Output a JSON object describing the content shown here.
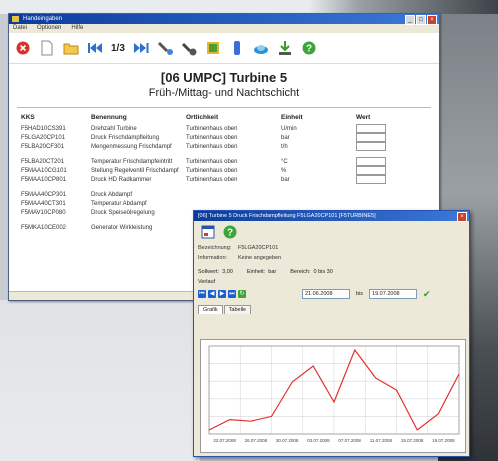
{
  "window": {
    "title": "Handeingaben",
    "menu": [
      "Datei",
      "Optionen",
      "Hilfe"
    ]
  },
  "toolbar": {
    "counter": "1/3"
  },
  "header": {
    "title": "[06 UMPC] Turbine 5",
    "subtitle": "Früh-/Mittag- und Nachtschicht"
  },
  "table": {
    "columns": [
      "KKS",
      "Benennung",
      "Ortlichkeit",
      "Einheit",
      "Wert"
    ],
    "rows": [
      {
        "kks": "F5HAD10CS391",
        "name": "Drehzahl Turbine",
        "ort": "Turbinenhaus oben",
        "unit": "U/min"
      },
      {
        "kks": "F5LGA20CP101",
        "name": "Druck Frischdampfleitung",
        "ort": "Turbinenhaus oben",
        "unit": "bar"
      },
      {
        "kks": "F5LBA20CF301",
        "name": "Mengenmessung Frischdampf",
        "ort": "Turbinenhaus oben",
        "unit": "t/h"
      },
      {
        "kks": "F5LBA20CT201",
        "name": "Temperatur Frischdampfeintritt",
        "ort": "Turbinenhaus oben",
        "unit": "°C"
      },
      {
        "kks": "F5MAA10CG101",
        "name": "Stellung Regelventil Frischdampf",
        "ort": "Turbinenhaus oben",
        "unit": "%"
      },
      {
        "kks": "F5MAA10CP801",
        "name": "Druck HD Radkammer",
        "ort": "Turbinenhaus oben",
        "unit": "bar"
      },
      {
        "kks": "F5MAA40CP301",
        "name": "Druck Abdampf",
        "ort": "",
        "unit": ""
      },
      {
        "kks": "F5MAA40CT301",
        "name": "Temperatur Abdampf",
        "ort": "",
        "unit": ""
      },
      {
        "kks": "F5MAV10CP080",
        "name": "Druck Speiseölregelung",
        "ort": "",
        "unit": ""
      },
      {
        "kks": "F5MKA10CE002",
        "name": "Generator Wirkleistung",
        "ort": "",
        "unit": ""
      }
    ]
  },
  "popup": {
    "title": "[06] Turbine 5 Druck Frischdampfleitung F5LGA20CP101 [F5TURBINE5]",
    "bezeichnung_label": "Bezeichnung:",
    "bezeichnung_value": "F5LGA20CP101",
    "information_label": "Information:",
    "information_value": "Keine angegeben",
    "sollwert_label": "Sollwert:",
    "sollwert_value": "3,00",
    "einheit_label": "Einheit:",
    "einheit_value": "bar",
    "bereich_label": "Bereich:",
    "bereich_value": "0 bis 30",
    "verlauf_label": "Verlauf",
    "date_from": "21.06.2008",
    "bis_label": "bis",
    "date_to": "19.07.2008",
    "tabs": [
      "Grafik",
      "Tabelle"
    ]
  },
  "colors": {
    "line": "#e43030",
    "title_start": "#0a3c9e",
    "title_end": "#3c79d8"
  },
  "chart_data": {
    "type": "line",
    "x": [
      "22.07.2008",
      "26.07.2008",
      "30.07.2008",
      "03.07.2008",
      "07.07.2008",
      "11.07.2008",
      "15.07.2008",
      "19.07.2008"
    ],
    "series": [
      {
        "values": [
          0.5,
          1.8,
          1.6,
          2.2,
          6.5,
          8.5,
          4.0,
          10.5,
          7.0,
          5.5,
          0.5,
          2.5,
          7.5
        ]
      }
    ],
    "ylim": [
      0,
      11
    ]
  }
}
